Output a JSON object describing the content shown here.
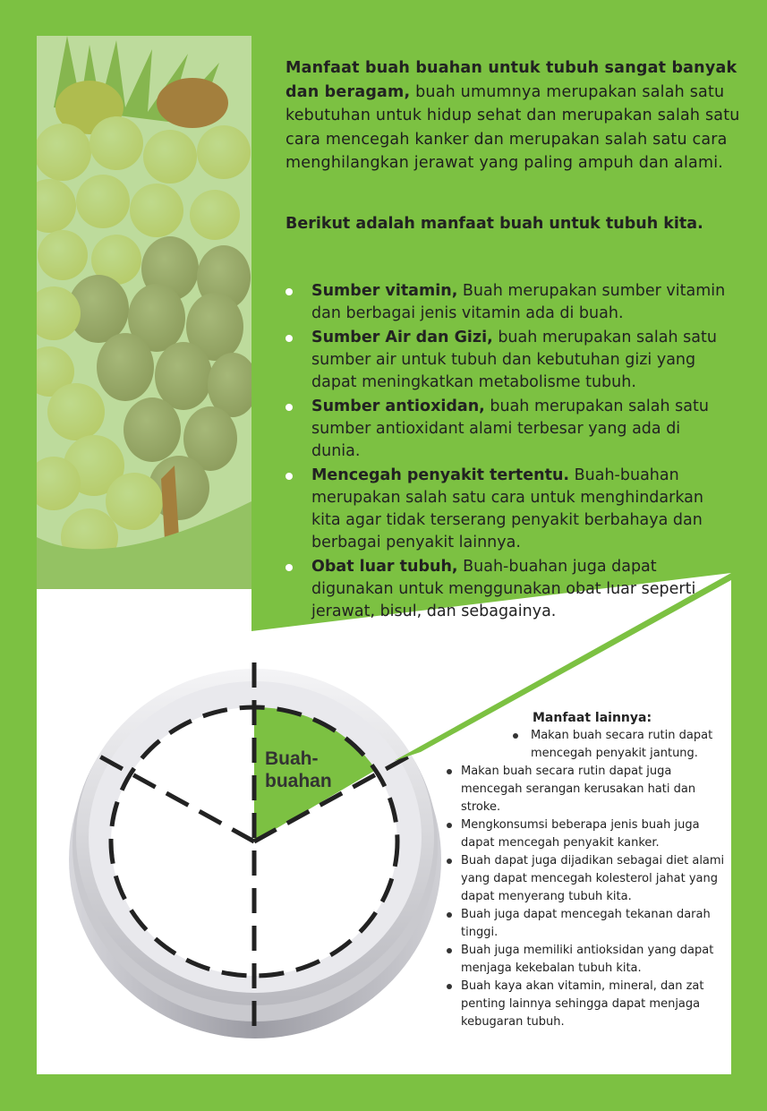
{
  "intro": {
    "lead": "Manfaat buah buahan untuk tubuh sangat banyak dan beragam,",
    "body": " buah umumnya merupakan salah satu kebutuhan untuk hidup sehat dan merupakan salah satu cara mencegah kanker dan merupakan salah satu cara menghilangkan jerawat yang paling ampuh dan alami."
  },
  "sub_heading": "Berikut adalah manfaat buah untuk tubuh kita.",
  "benefits": [
    {
      "title": "Sumber vitamin,",
      "text": " Buah merupakan sumber vitamin dan berbagai jenis vitamin ada di buah."
    },
    {
      "title": "Sumber Air dan Gizi,",
      "text": " buah merupakan salah satu sumber air untuk tubuh dan kebutuhan gizi yang dapat meningkatkan metabolisme tubuh."
    },
    {
      "title": "Sumber antioxidan,",
      "text": " buah merupakan salah satu sumber antioxidant alami terbesar yang ada di dunia."
    },
    {
      "title": "Mencegah penyakit tertentu.",
      "text": " Buah-buahan merupakan salah satu cara untuk menghindarkan kita agar tidak terserang penyakit berbahaya dan berbagai penyakit lainnya."
    },
    {
      "title": "Obat luar tubuh,",
      "text": " Buah-buahan juga dapat digunakan untuk menggunakan obat luar seperti jerawat, bisul, dan sebagainya."
    }
  ],
  "clock_label": "Buah-buahan",
  "other": {
    "heading": "Manfaat lainnya:",
    "items": [
      "Makan buah secara rutin dapat mencegah penyakit jantung.",
      "Makan buah secara rutin dapat juga mencegah serangan kerusakan hati dan stroke.",
      "Mengkonsumsi beberapa jenis buah juga dapat mencegah penyakit kanker.",
      "Buah dapat juga dijadikan sebagai diet alami yang dapat mencegah kolesterol jahat yang dapat menyerang tubuh kita.",
      "Buah juga dapat mencegah tekanan darah tinggi.",
      "Buah juga memiliki antioksidan yang dapat menjaga kekebalan tubuh kita.",
      "Buah kaya akan vitamin, mineral, dan zat penting lainnya sehingga dapat menjaga kebugaran tubuh."
    ]
  },
  "colors": {
    "green": "#7cc142",
    "white": "#ffffff",
    "text": "#222222"
  }
}
